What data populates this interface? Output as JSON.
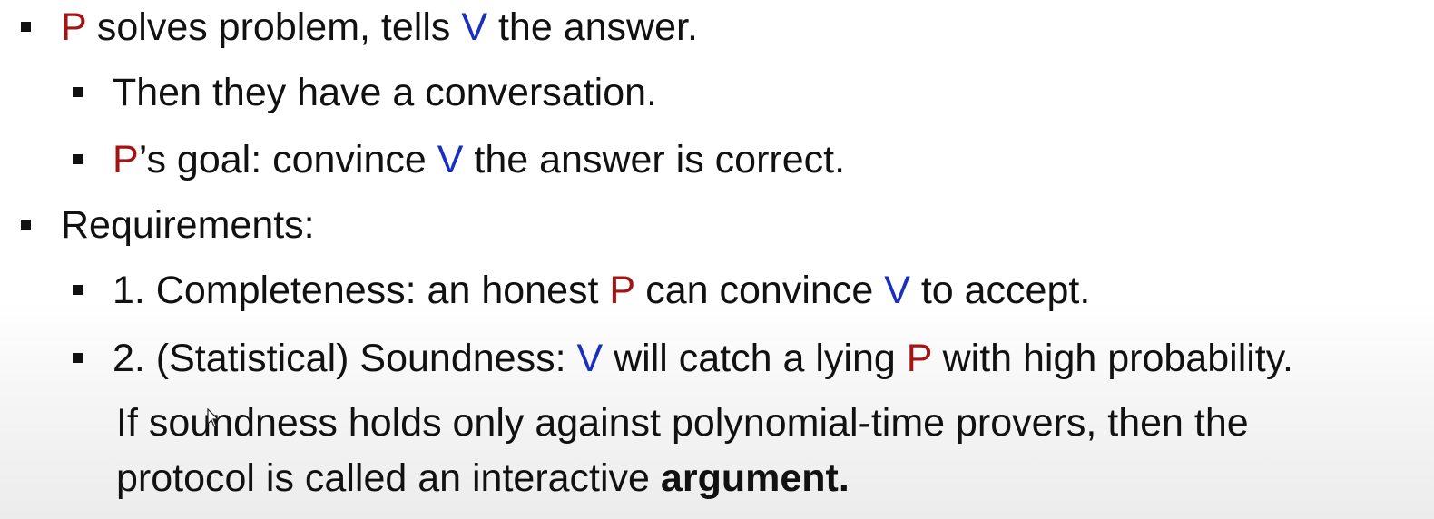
{
  "slide": {
    "bullets": [
      {
        "level": 1,
        "parts": {
          "p": "P",
          "text1": " solves problem, tells ",
          "v": "V",
          "text2": " the answer."
        }
      },
      {
        "level": 2,
        "parts": {
          "text1": "Then they have a conversation."
        }
      },
      {
        "level": 2,
        "parts": {
          "p": "P",
          "text1": "’s goal: convince ",
          "v": "V",
          "text2": " the answer is correct."
        }
      },
      {
        "level": 1,
        "parts": {
          "text1": "Requirements:"
        }
      },
      {
        "level": 2,
        "parts": {
          "text1": "1. Completeness: an honest ",
          "p": "P",
          "text2": " can convince ",
          "v": "V",
          "text3": " to accept."
        }
      },
      {
        "level": 2,
        "parts": {
          "text1": "2. (Statistical) Soundness: ",
          "v": "V",
          "text2": " will catch a lying ",
          "p": "P",
          "text3": " with high probability."
        }
      }
    ],
    "note": {
      "line1": "If soundness holds only against polynomial-time provers, then the",
      "line2_prefix": "protocol is called an interactive ",
      "line2_bold": "argument."
    }
  },
  "colors": {
    "prover": "#a41414",
    "verifier": "#1a2ec0",
    "text": "#111111"
  },
  "icons": {
    "bullet": "square-bullet-icon",
    "cursor": "mouse-pointer-icon"
  }
}
